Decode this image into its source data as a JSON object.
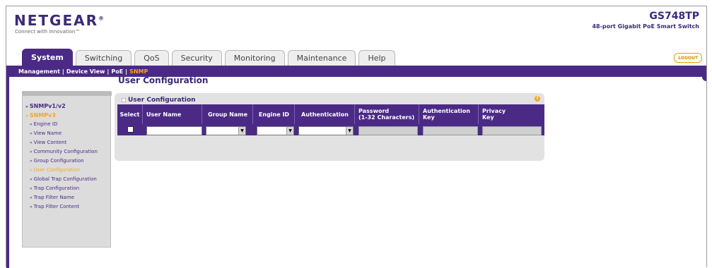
{
  "brand": {
    "logo": "NETGEAR",
    "reg": "®",
    "tagline": "Connect with Innovation™"
  },
  "device": {
    "model": "GS748TP",
    "description": "48-port Gigabit PoE Smart Switch"
  },
  "tabs": [
    {
      "label": "System",
      "active": true
    },
    {
      "label": "Switching",
      "active": false
    },
    {
      "label": "QoS",
      "active": false
    },
    {
      "label": "Security",
      "active": false
    },
    {
      "label": "Monitoring",
      "active": false
    },
    {
      "label": "Maintenance",
      "active": false
    },
    {
      "label": "Help",
      "active": false
    }
  ],
  "logout_label": "LOGOUT",
  "subnav": [
    {
      "label": "Management"
    },
    {
      "label": "Device View"
    },
    {
      "label": "PoE"
    },
    {
      "label": "SNMP",
      "current": true
    }
  ],
  "sidebar": {
    "items": [
      {
        "label": "SNMPv1/v2"
      },
      {
        "label": "SNMPv3"
      },
      {
        "label": "Engine ID"
      },
      {
        "label": "View Name"
      },
      {
        "label": "View Content"
      },
      {
        "label": "Community Configuration"
      },
      {
        "label": "Group Configuration"
      },
      {
        "label": "User Configuration",
        "active": true
      },
      {
        "label": "Global Trap Configuration"
      },
      {
        "label": "Trap Configuration"
      },
      {
        "label": "Trap Filter Name"
      },
      {
        "label": "Trap Filter Content"
      }
    ]
  },
  "page_title": "User Configuration",
  "panel": {
    "title": "User Configuration",
    "help_glyph": "?",
    "columns": [
      "Select",
      "User Name",
      "Group Name",
      "Engine ID",
      "Authentication",
      "Password\n(1-32 Characters)",
      "Authentication\nKey",
      "Privacy\nKey"
    ],
    "row": {
      "select_checked": false,
      "user_name": "",
      "group_name": "",
      "engine_id": "",
      "authentication": "",
      "password": "",
      "auth_key": "",
      "privacy_key": ""
    }
  },
  "colors": {
    "brand_purple": "#4b2a86",
    "accent_orange": "#f5a623",
    "panel_gray": "#e2e2e2"
  }
}
